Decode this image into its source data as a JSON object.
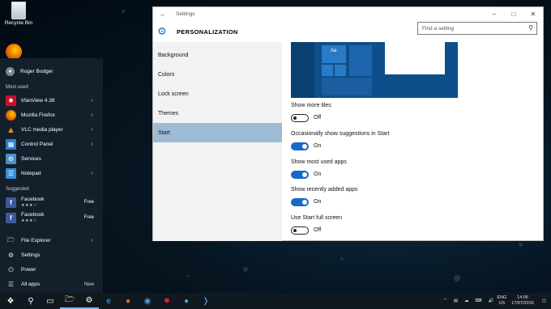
{
  "desktop": {
    "recycle_bin_label": "Recycle Bin"
  },
  "start_menu": {
    "user_name": "Roger Bodger",
    "most_used_heading": "Most used",
    "most_used": [
      {
        "label": "IrfanView 4.38",
        "icon": "irfanview-icon",
        "color": "#c8102e"
      },
      {
        "label": "Mozilla Firefox",
        "icon": "firefox-icon",
        "color": "#e66000"
      },
      {
        "label": "VLC media player",
        "icon": "vlc-icon",
        "color": "#f28c00"
      },
      {
        "label": "Control Panel",
        "icon": "control-panel-icon",
        "color": "#2b7fd1"
      },
      {
        "label": "Services",
        "icon": "services-icon",
        "color": "#4a8fc7"
      },
      {
        "label": "Notepad",
        "icon": "notepad-icon",
        "color": "#3c8fd6"
      }
    ],
    "suggested_heading": "Suggested",
    "suggested": [
      {
        "label": "Facebook",
        "rating": "★★★☆",
        "price": "Free"
      },
      {
        "label": "Facebook",
        "rating": "★★★☆",
        "price": "Free"
      }
    ],
    "bottom": {
      "file_explorer": "File Explorer",
      "settings": "Settings",
      "power": "Power",
      "all_apps": "All apps",
      "new_badge": "New"
    }
  },
  "settings_window": {
    "title": "Settings",
    "header": "PERSONALIZATION",
    "search_placeholder": "Find a setting",
    "nav": [
      "Background",
      "Colors",
      "Lock screen",
      "Themes",
      "Start"
    ],
    "selected_nav": "Start",
    "preview_tile_text": "Aa",
    "options": [
      {
        "label": "Show more tiles",
        "state": "Off"
      },
      {
        "label": "Occasionally show suggestions in Start",
        "state": "On"
      },
      {
        "label": "Show most used apps",
        "state": "On"
      },
      {
        "label": "Show recently added apps",
        "state": "On"
      },
      {
        "label": "Use Start full screen",
        "state": "Off"
      }
    ]
  },
  "taskbar": {
    "lang_top": "ENG",
    "lang_bottom": "US",
    "time": "14:06",
    "date": "17/07/2016"
  },
  "colors": {
    "accent": "#1569c7",
    "nav_selected": "#9dbbd4",
    "start_bg": "#14202c"
  }
}
